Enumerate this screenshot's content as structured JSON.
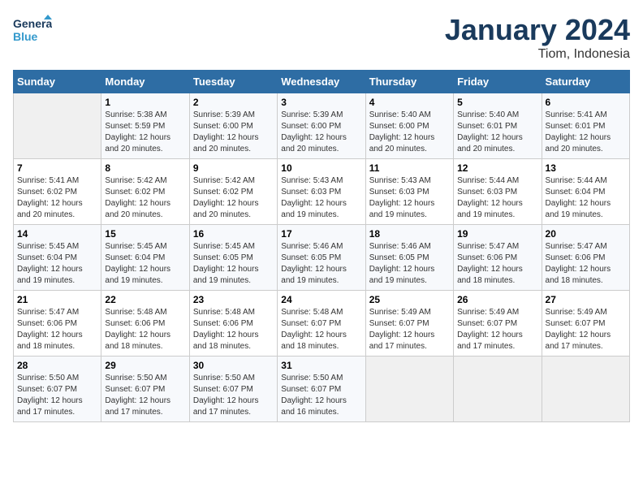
{
  "header": {
    "logo_general": "General",
    "logo_blue": "Blue",
    "month": "January 2024",
    "location": "Tiom, Indonesia"
  },
  "weekdays": [
    "Sunday",
    "Monday",
    "Tuesday",
    "Wednesday",
    "Thursday",
    "Friday",
    "Saturday"
  ],
  "weeks": [
    [
      {
        "day": "",
        "info": ""
      },
      {
        "day": "1",
        "info": "Sunrise: 5:38 AM\nSunset: 5:59 PM\nDaylight: 12 hours\nand 20 minutes."
      },
      {
        "day": "2",
        "info": "Sunrise: 5:39 AM\nSunset: 6:00 PM\nDaylight: 12 hours\nand 20 minutes."
      },
      {
        "day": "3",
        "info": "Sunrise: 5:39 AM\nSunset: 6:00 PM\nDaylight: 12 hours\nand 20 minutes."
      },
      {
        "day": "4",
        "info": "Sunrise: 5:40 AM\nSunset: 6:00 PM\nDaylight: 12 hours\nand 20 minutes."
      },
      {
        "day": "5",
        "info": "Sunrise: 5:40 AM\nSunset: 6:01 PM\nDaylight: 12 hours\nand 20 minutes."
      },
      {
        "day": "6",
        "info": "Sunrise: 5:41 AM\nSunset: 6:01 PM\nDaylight: 12 hours\nand 20 minutes."
      }
    ],
    [
      {
        "day": "7",
        "info": "Sunrise: 5:41 AM\nSunset: 6:02 PM\nDaylight: 12 hours\nand 20 minutes."
      },
      {
        "day": "8",
        "info": "Sunrise: 5:42 AM\nSunset: 6:02 PM\nDaylight: 12 hours\nand 20 minutes."
      },
      {
        "day": "9",
        "info": "Sunrise: 5:42 AM\nSunset: 6:02 PM\nDaylight: 12 hours\nand 20 minutes."
      },
      {
        "day": "10",
        "info": "Sunrise: 5:43 AM\nSunset: 6:03 PM\nDaylight: 12 hours\nand 19 minutes."
      },
      {
        "day": "11",
        "info": "Sunrise: 5:43 AM\nSunset: 6:03 PM\nDaylight: 12 hours\nand 19 minutes."
      },
      {
        "day": "12",
        "info": "Sunrise: 5:44 AM\nSunset: 6:03 PM\nDaylight: 12 hours\nand 19 minutes."
      },
      {
        "day": "13",
        "info": "Sunrise: 5:44 AM\nSunset: 6:04 PM\nDaylight: 12 hours\nand 19 minutes."
      }
    ],
    [
      {
        "day": "14",
        "info": "Sunrise: 5:45 AM\nSunset: 6:04 PM\nDaylight: 12 hours\nand 19 minutes."
      },
      {
        "day": "15",
        "info": "Sunrise: 5:45 AM\nSunset: 6:04 PM\nDaylight: 12 hours\nand 19 minutes."
      },
      {
        "day": "16",
        "info": "Sunrise: 5:45 AM\nSunset: 6:05 PM\nDaylight: 12 hours\nand 19 minutes."
      },
      {
        "day": "17",
        "info": "Sunrise: 5:46 AM\nSunset: 6:05 PM\nDaylight: 12 hours\nand 19 minutes."
      },
      {
        "day": "18",
        "info": "Sunrise: 5:46 AM\nSunset: 6:05 PM\nDaylight: 12 hours\nand 19 minutes."
      },
      {
        "day": "19",
        "info": "Sunrise: 5:47 AM\nSunset: 6:06 PM\nDaylight: 12 hours\nand 18 minutes."
      },
      {
        "day": "20",
        "info": "Sunrise: 5:47 AM\nSunset: 6:06 PM\nDaylight: 12 hours\nand 18 minutes."
      }
    ],
    [
      {
        "day": "21",
        "info": "Sunrise: 5:47 AM\nSunset: 6:06 PM\nDaylight: 12 hours\nand 18 minutes."
      },
      {
        "day": "22",
        "info": "Sunrise: 5:48 AM\nSunset: 6:06 PM\nDaylight: 12 hours\nand 18 minutes."
      },
      {
        "day": "23",
        "info": "Sunrise: 5:48 AM\nSunset: 6:06 PM\nDaylight: 12 hours\nand 18 minutes."
      },
      {
        "day": "24",
        "info": "Sunrise: 5:48 AM\nSunset: 6:07 PM\nDaylight: 12 hours\nand 18 minutes."
      },
      {
        "day": "25",
        "info": "Sunrise: 5:49 AM\nSunset: 6:07 PM\nDaylight: 12 hours\nand 17 minutes."
      },
      {
        "day": "26",
        "info": "Sunrise: 5:49 AM\nSunset: 6:07 PM\nDaylight: 12 hours\nand 17 minutes."
      },
      {
        "day": "27",
        "info": "Sunrise: 5:49 AM\nSunset: 6:07 PM\nDaylight: 12 hours\nand 17 minutes."
      }
    ],
    [
      {
        "day": "28",
        "info": "Sunrise: 5:50 AM\nSunset: 6:07 PM\nDaylight: 12 hours\nand 17 minutes."
      },
      {
        "day": "29",
        "info": "Sunrise: 5:50 AM\nSunset: 6:07 PM\nDaylight: 12 hours\nand 17 minutes."
      },
      {
        "day": "30",
        "info": "Sunrise: 5:50 AM\nSunset: 6:07 PM\nDaylight: 12 hours\nand 17 minutes."
      },
      {
        "day": "31",
        "info": "Sunrise: 5:50 AM\nSunset: 6:07 PM\nDaylight: 12 hours\nand 16 minutes."
      },
      {
        "day": "",
        "info": ""
      },
      {
        "day": "",
        "info": ""
      },
      {
        "day": "",
        "info": ""
      }
    ]
  ]
}
